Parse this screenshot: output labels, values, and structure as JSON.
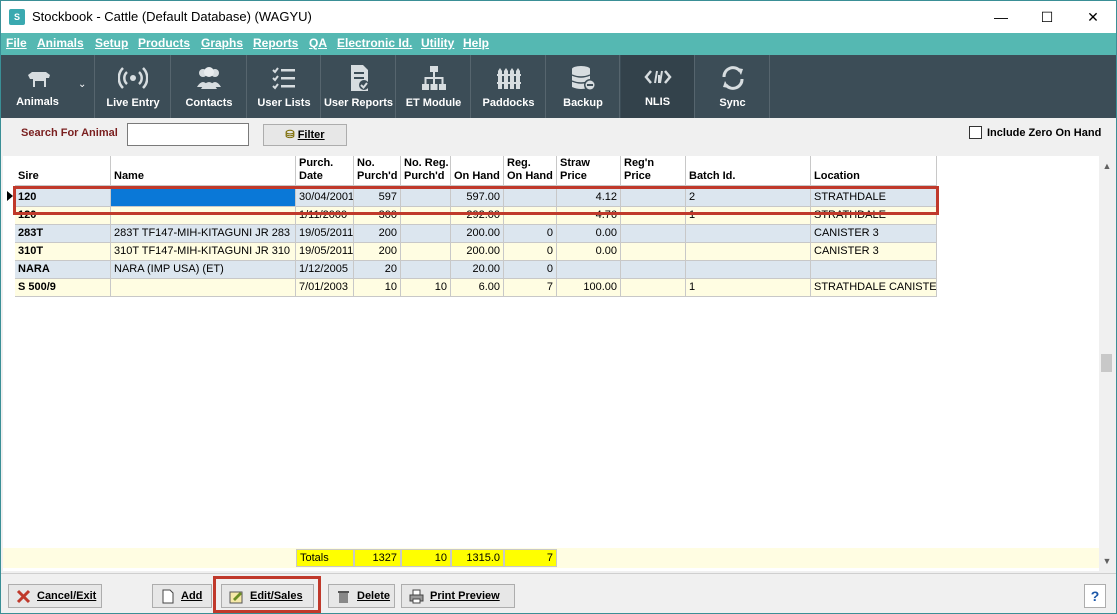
{
  "window": {
    "title": "Stockbook - Cattle (Default Database) (WAGYU)",
    "minimize": "—",
    "maximize": "☐",
    "close": "✕"
  },
  "menu": [
    "File",
    "Animals",
    "Setup",
    "Products",
    "Graphs",
    "Reports",
    "QA",
    "Electronic Id.",
    "Utility",
    "Help"
  ],
  "toolbar": [
    {
      "label": "Animals",
      "icon": "cow-icon"
    },
    {
      "label": "Live Entry",
      "icon": "broadcast-icon"
    },
    {
      "label": "Contacts",
      "icon": "people-icon"
    },
    {
      "label": "User Lists",
      "icon": "checklist-icon"
    },
    {
      "label": "User Reports",
      "icon": "report-icon"
    },
    {
      "label": "ET Module",
      "icon": "hierarchy-icon"
    },
    {
      "label": "Paddocks",
      "icon": "fence-icon"
    },
    {
      "label": "Backup",
      "icon": "database-icon"
    },
    {
      "label": "NLIS",
      "icon": "nlis-tag-icon"
    },
    {
      "label": "Sync",
      "icon": "sync-icon"
    }
  ],
  "search": {
    "label": "Search For Animal",
    "value": "",
    "filter_label": "Filter",
    "include_zero_label": "Include Zero On Hand",
    "include_zero_checked": false
  },
  "grid": {
    "columns": [
      {
        "line1": "Sire",
        "line2": ""
      },
      {
        "line1": "Name",
        "line2": ""
      },
      {
        "line1": "Purch.",
        "line2": "Date"
      },
      {
        "line1": "No.",
        "line2": "Purch'd"
      },
      {
        "line1": "No. Reg.",
        "line2": "Purch'd"
      },
      {
        "line1": "On Hand",
        "line2": ""
      },
      {
        "line1": "Reg.",
        "line2": "On Hand"
      },
      {
        "line1": "Straw",
        "line2": "Price"
      },
      {
        "line1": "Reg'n",
        "line2": "Price"
      },
      {
        "line1": "Batch Id.",
        "line2": ""
      },
      {
        "line1": "Location",
        "line2": ""
      }
    ],
    "rows": [
      [
        "120",
        "",
        "30/04/2001",
        "597",
        "",
        "597.00",
        "",
        "4.12",
        "",
        "2",
        "STRATHDALE"
      ],
      [
        "120",
        "",
        "1/11/2000",
        "300",
        "",
        "292.00",
        "",
        "4.76",
        "",
        "1",
        "STRATHDALE"
      ],
      [
        "283T",
        "283T TF147-MIH-KITAGUNI JR 283",
        "19/05/2011",
        "200",
        "",
        "200.00",
        "0",
        "0.00",
        "",
        "",
        "CANISTER 3"
      ],
      [
        "310T",
        "310T TF147-MIH-KITAGUNI JR 310",
        "19/05/2011",
        "200",
        "",
        "200.00",
        "0",
        "0.00",
        "",
        "",
        "CANISTER 3"
      ],
      [
        "NARA",
        "NARA (IMP USA) (ET)",
        "1/12/2005",
        "20",
        "",
        "20.00",
        "0",
        "",
        "",
        "",
        ""
      ],
      [
        "S 500/9",
        "",
        "7/01/2003",
        "10",
        "10",
        "6.00",
        "7",
        "100.00",
        "",
        "1",
        "STRATHDALE CANISTER"
      ]
    ],
    "totals": {
      "label": "Totals",
      "purchased": "1327",
      "reg_purchased": "10",
      "on_hand": "1315.0",
      "reg_on_hand": "7"
    }
  },
  "buttons": {
    "cancel": "Cancel/Exit",
    "add": "Add",
    "edit": "Edit/Sales",
    "delete": "Delete",
    "print": "Print Preview",
    "help": "?"
  },
  "colors": {
    "menu": "#55b8b2",
    "toolbar": "#3c4d57",
    "highlight": "#c0392b",
    "selected": "#0a78d7"
  }
}
